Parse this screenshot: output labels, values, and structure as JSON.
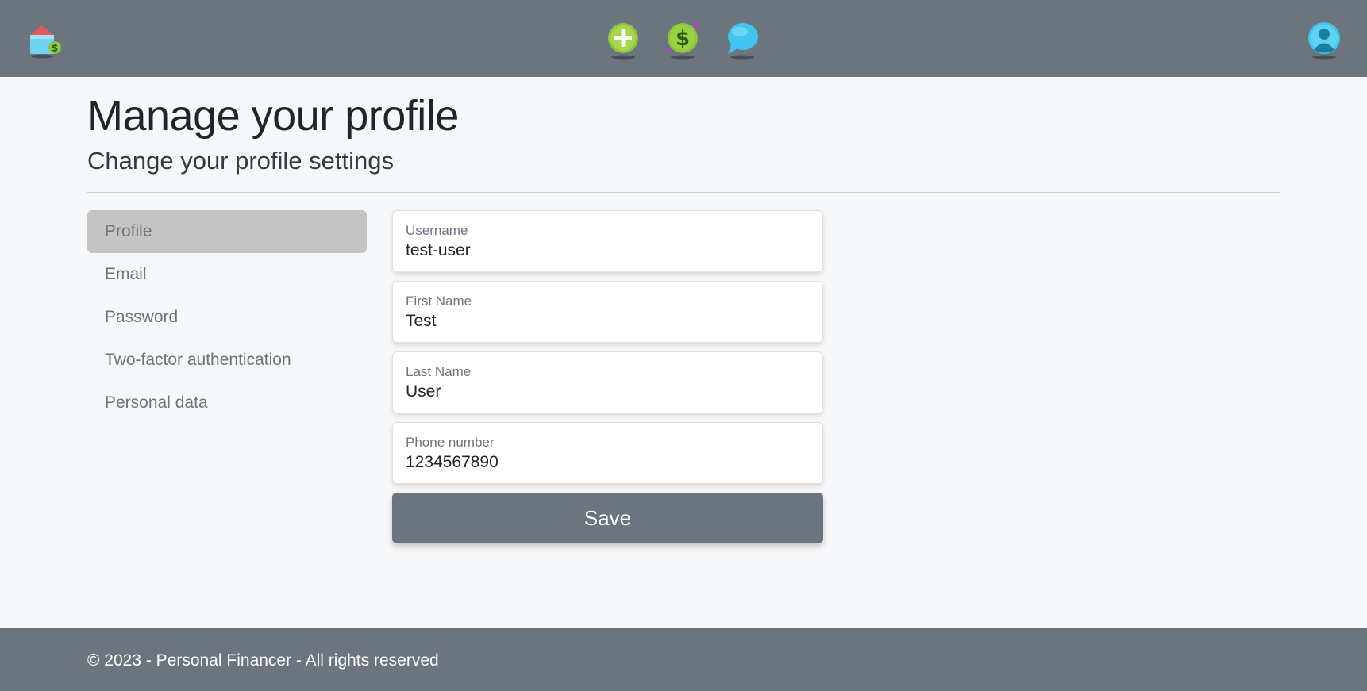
{
  "header": {
    "icons": [
      "home-finance-icon",
      "add-icon",
      "money-icon",
      "chat-icon",
      "user-profile-icon"
    ]
  },
  "page": {
    "title": "Manage your profile",
    "subtitle": "Change your profile settings"
  },
  "sidebar": {
    "items": [
      {
        "label": "Profile",
        "active": true
      },
      {
        "label": "Email",
        "active": false
      },
      {
        "label": "Password",
        "active": false
      },
      {
        "label": "Two-factor authentication",
        "active": false
      },
      {
        "label": "Personal data",
        "active": false
      }
    ]
  },
  "form": {
    "username": {
      "label": "Username",
      "value": "test-user"
    },
    "first_name": {
      "label": "First Name",
      "value": "Test"
    },
    "last_name": {
      "label": "Last Name",
      "value": "User"
    },
    "phone": {
      "label": "Phone number",
      "value": "1234567890"
    },
    "save_label": "Save"
  },
  "footer": {
    "text": "© 2023 - Personal Financer - All rights reserved"
  },
  "colors": {
    "navbar": "#6c757d",
    "background": "#f6f7f9",
    "active_item": "#c4c4c4",
    "button": "#6c757d"
  }
}
